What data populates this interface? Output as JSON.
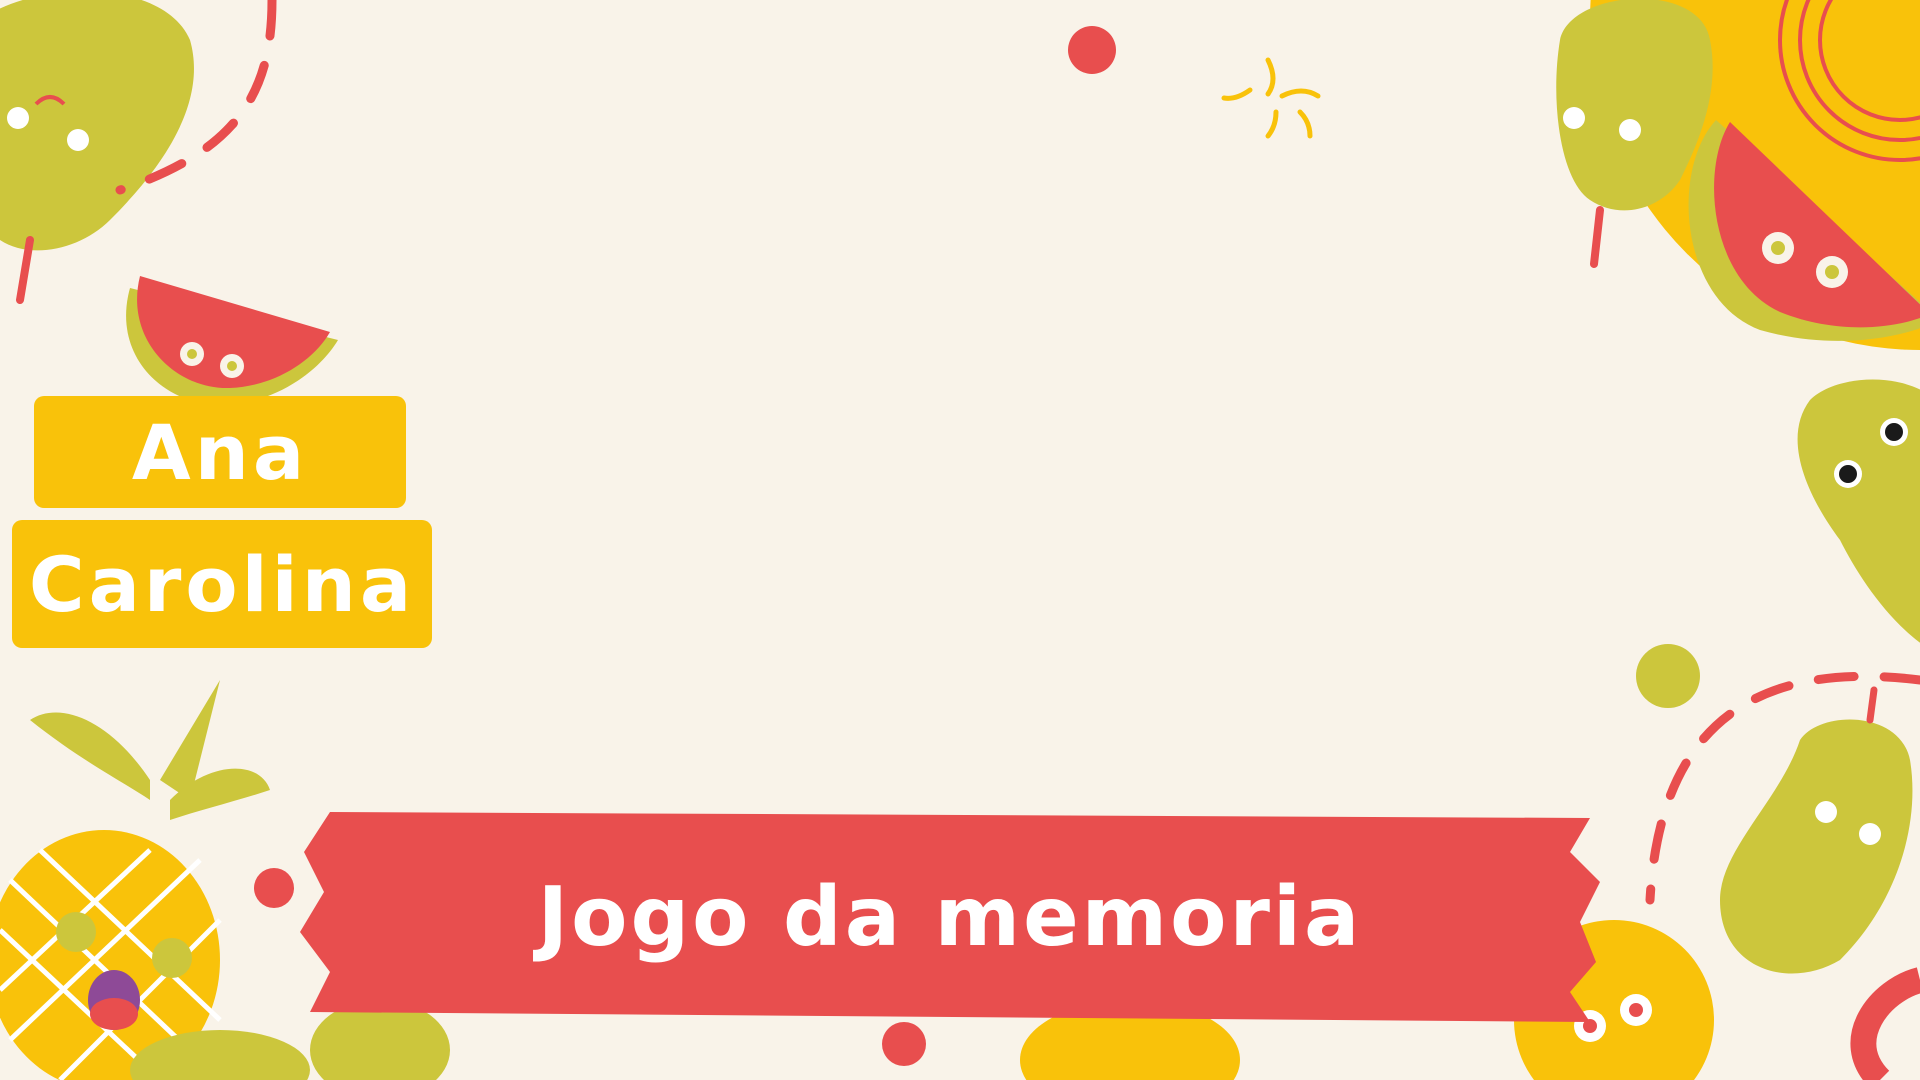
{
  "player": {
    "first_name": "Ana",
    "last_name": "Carolina"
  },
  "title": "Jogo da memoria",
  "colors": {
    "background": "#F9F3E9",
    "accent_red": "#E84E4E",
    "accent_yellow": "#F9C20A",
    "pear_green": "#CCC63C",
    "text_white": "#FFFFFF"
  },
  "decor_icons": [
    "pear-icon",
    "watermelon-icon",
    "pineapple-icon",
    "sun-icon",
    "dashed-path-icon",
    "sparkle-icon"
  ]
}
